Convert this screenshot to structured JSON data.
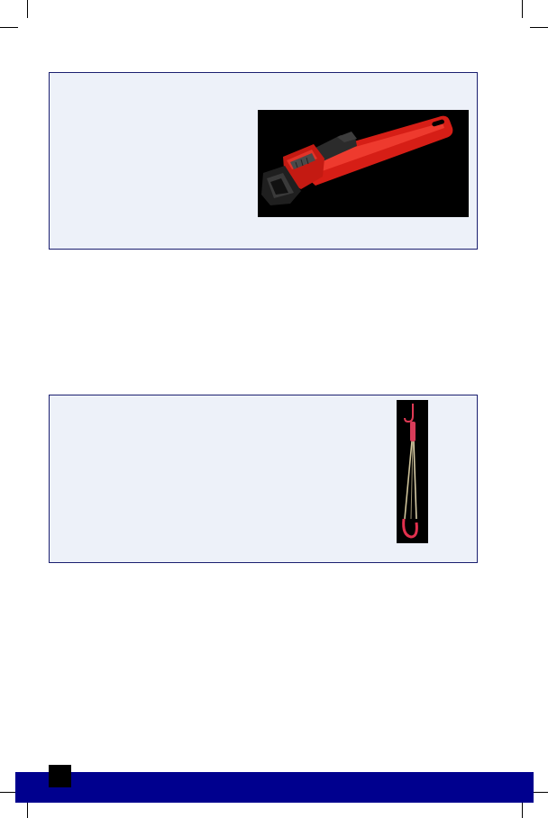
{
  "page": {
    "background": "#ffffff",
    "panel_fill": "#edf1f9",
    "panel_border": "#1a1f70",
    "footer_color": "#00008e"
  },
  "panels": [
    {
      "image": "pipe-wrench-photo",
      "image_background": "#000000"
    },
    {
      "image": "drain-snake-tool-photo",
      "image_background": "#000000"
    }
  ],
  "footer": {
    "page_number": ""
  }
}
